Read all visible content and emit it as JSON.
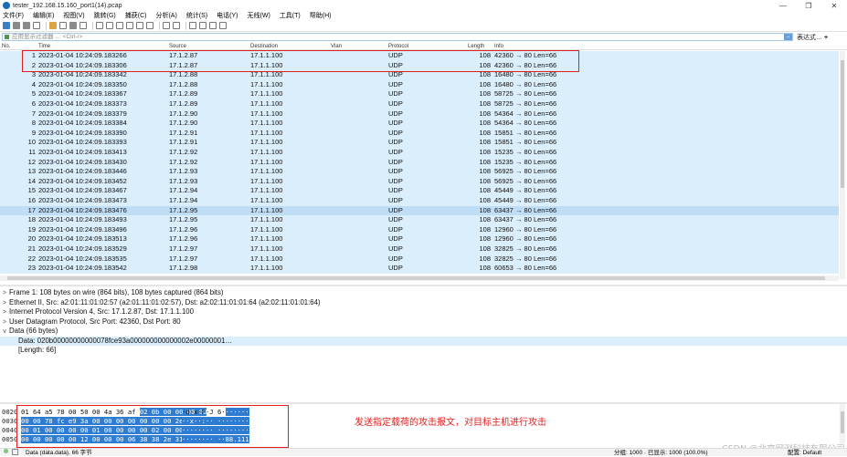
{
  "window": {
    "title": "tester_192.168.15.160_port1(14).pcap",
    "controls": [
      "—",
      "❐",
      "✕"
    ]
  },
  "menu": [
    "文件(F)",
    "编辑(E)",
    "视图(V)",
    "跳转(G)",
    "捕获(C)",
    "分析(A)",
    "统计(S)",
    "电话(Y)",
    "无线(W)",
    "工具(T)",
    "帮助(H)"
  ],
  "filter": {
    "placeholder": "应用显示过滤器 … <Ctrl-/>",
    "expression_label": "表达式…",
    "add_label": "+"
  },
  "packet_list": {
    "columns": [
      "No.",
      "Time",
      "Source",
      "Destination",
      "Vlan",
      "Protocol",
      "Length",
      "Info"
    ],
    "rows": [
      {
        "no": "1",
        "time": "2023-01-04 10:24:09.183266",
        "src": "17.1.2.87",
        "dst": "17.1.1.100",
        "proto": "UDP",
        "len": "108",
        "info": "42360 → 80 Len=66"
      },
      {
        "no": "2",
        "time": "2023-01-04 10:24:09.183306",
        "src": "17.1.2.87",
        "dst": "17.1.1.100",
        "proto": "UDP",
        "len": "108",
        "info": "42360 → 80 Len=66"
      },
      {
        "no": "3",
        "time": "2023-01-04 10:24:09.183342",
        "src": "17.1.2.88",
        "dst": "17.1.1.100",
        "proto": "UDP",
        "len": "108",
        "info": "16480 → 80 Len=66"
      },
      {
        "no": "4",
        "time": "2023-01-04 10:24:09.183350",
        "src": "17.1.2.88",
        "dst": "17.1.1.100",
        "proto": "UDP",
        "len": "108",
        "info": "16480 → 80 Len=66"
      },
      {
        "no": "5",
        "time": "2023-01-04 10:24:09.183367",
        "src": "17.1.2.89",
        "dst": "17.1.1.100",
        "proto": "UDP",
        "len": "108",
        "info": "58725 → 80 Len=66"
      },
      {
        "no": "6",
        "time": "2023-01-04 10:24:09.183373",
        "src": "17.1.2.89",
        "dst": "17.1.1.100",
        "proto": "UDP",
        "len": "108",
        "info": "58725 → 80 Len=66"
      },
      {
        "no": "7",
        "time": "2023-01-04 10:24:09.183379",
        "src": "17.1.2.90",
        "dst": "17.1.1.100",
        "proto": "UDP",
        "len": "108",
        "info": "54364 → 80 Len=66"
      },
      {
        "no": "8",
        "time": "2023-01-04 10:24:09.183384",
        "src": "17.1.2.90",
        "dst": "17.1.1.100",
        "proto": "UDP",
        "len": "108",
        "info": "54364 → 80 Len=66"
      },
      {
        "no": "9",
        "time": "2023-01-04 10:24:09.183390",
        "src": "17.1.2.91",
        "dst": "17.1.1.100",
        "proto": "UDP",
        "len": "108",
        "info": "15851 → 80 Len=66"
      },
      {
        "no": "10",
        "time": "2023-01-04 10:24:09.183393",
        "src": "17.1.2.91",
        "dst": "17.1.1.100",
        "proto": "UDP",
        "len": "108",
        "info": "15851 → 80 Len=66"
      },
      {
        "no": "11",
        "time": "2023-01-04 10:24:09.183413",
        "src": "17.1.2.92",
        "dst": "17.1.1.100",
        "proto": "UDP",
        "len": "108",
        "info": "15235 → 80 Len=66"
      },
      {
        "no": "12",
        "time": "2023-01-04 10:24:09.183430",
        "src": "17.1.2.92",
        "dst": "17.1.1.100",
        "proto": "UDP",
        "len": "108",
        "info": "15235 → 80 Len=66"
      },
      {
        "no": "13",
        "time": "2023-01-04 10:24:09.183446",
        "src": "17.1.2.93",
        "dst": "17.1.1.100",
        "proto": "UDP",
        "len": "108",
        "info": "56925 → 80 Len=66"
      },
      {
        "no": "14",
        "time": "2023-01-04 10:24:09.183452",
        "src": "17.1.2.93",
        "dst": "17.1.1.100",
        "proto": "UDP",
        "len": "108",
        "info": "56925 → 80 Len=66"
      },
      {
        "no": "15",
        "time": "2023-01-04 10:24:09.183467",
        "src": "17.1.2.94",
        "dst": "17.1.1.100",
        "proto": "UDP",
        "len": "108",
        "info": "45449 → 80 Len=66"
      },
      {
        "no": "16",
        "time": "2023-01-04 10:24:09.183473",
        "src": "17.1.2.94",
        "dst": "17.1.1.100",
        "proto": "UDP",
        "len": "108",
        "info": "45449 → 80 Len=66"
      },
      {
        "no": "17",
        "time": "2023-01-04 10:24:09.183476",
        "src": "17.1.2.95",
        "dst": "17.1.1.100",
        "proto": "UDP",
        "len": "108",
        "info": "63437 → 80 Len=66"
      },
      {
        "no": "18",
        "time": "2023-01-04 10:24:09.183493",
        "src": "17.1.2.95",
        "dst": "17.1.1.100",
        "proto": "UDP",
        "len": "108",
        "info": "63437 → 80 Len=66"
      },
      {
        "no": "19",
        "time": "2023-01-04 10:24:09.183496",
        "src": "17.1.2.96",
        "dst": "17.1.1.100",
        "proto": "UDP",
        "len": "108",
        "info": "12960 → 80 Len=66"
      },
      {
        "no": "20",
        "time": "2023-01-04 10:24:09.183513",
        "src": "17.1.2.96",
        "dst": "17.1.1.100",
        "proto": "UDP",
        "len": "108",
        "info": "12960 → 80 Len=66"
      },
      {
        "no": "21",
        "time": "2023-01-04 10:24:09.183529",
        "src": "17.1.2.97",
        "dst": "17.1.1.100",
        "proto": "UDP",
        "len": "108",
        "info": "32825 → 80 Len=66"
      },
      {
        "no": "22",
        "time": "2023-01-04 10:24:09.183535",
        "src": "17.1.2.97",
        "dst": "17.1.1.100",
        "proto": "UDP",
        "len": "108",
        "info": "32825 → 80 Len=66"
      },
      {
        "no": "23",
        "time": "2023-01-04 10:24:09.183542",
        "src": "17.1.2.98",
        "dst": "17.1.1.100",
        "proto": "UDP",
        "len": "108",
        "info": "60653 → 80 Len=66"
      }
    ]
  },
  "details": {
    "rows": [
      {
        "arrow": ">",
        "text": "Frame 1: 108 bytes on wire (864 bits), 108 bytes captured (864 bits)"
      },
      {
        "arrow": ">",
        "text": "Ethernet II, Src: a2:01:11:01:02:57 (a2:01:11:01:02:57), Dst: a2:02:11:01:01:64 (a2:02:11:01:01:64)"
      },
      {
        "arrow": ">",
        "text": "Internet Protocol Version 4, Src: 17.1.2.87, Dst: 17.1.1.100"
      },
      {
        "arrow": ">",
        "text": "User Datagram Protocol, Src Port: 42360, Dst Port: 80"
      },
      {
        "arrow": "v",
        "text": "Data (66 bytes)"
      },
      {
        "arrow": "",
        "text": "Data: 020b00000000000078fce93a000000000000002e00000001…"
      },
      {
        "arrow": "",
        "text": "[Length: 66]"
      }
    ]
  },
  "hex": {
    "rows": [
      {
        "off": "0020",
        "pre": "01 64 a5 78 00 50 00 4a  36 af ",
        "sel": "02 0b 00 00 00 00",
        "ascii_pre": "·d·x·P·J 6·",
        "ascii_sel": "······"
      },
      {
        "off": "0030",
        "pre": "",
        "sel": "00 00 78 fc e9 3a 00 00  00 00 00 00 00 2e 00 00",
        "ascii_pre": "",
        "ascii_sel": "··x··:·· ········"
      },
      {
        "off": "0040",
        "pre": "",
        "sel": "00 01 00 00 00 00 01 00  00 00 00 02 00 00 00 00",
        "ascii_pre": "",
        "ascii_sel": "········ ········"
      },
      {
        "off": "0050",
        "pre": "",
        "sel": "00 00 00 00 00 12 00 00  00 06 38 38 2e 31 31 31",
        "ascii_pre": "",
        "ascii_sel": "········ ··88.111"
      }
    ],
    "annotation": "发送指定载荷的攻击报文，对目标主机进行攻击"
  },
  "status": {
    "left": "Data (data.data), 66 字节",
    "packets": "分组: 1000 · 已显示: 1000 (100.0%)",
    "profile": "配置: Default"
  },
  "watermark": "CSDN @北京网测科技有限公司",
  "colors": {
    "row_bg": "#daeefb",
    "selected_row": "#c0ddf6",
    "highlight_box": "#e02020",
    "hex_selection": "#2f7dd3"
  }
}
